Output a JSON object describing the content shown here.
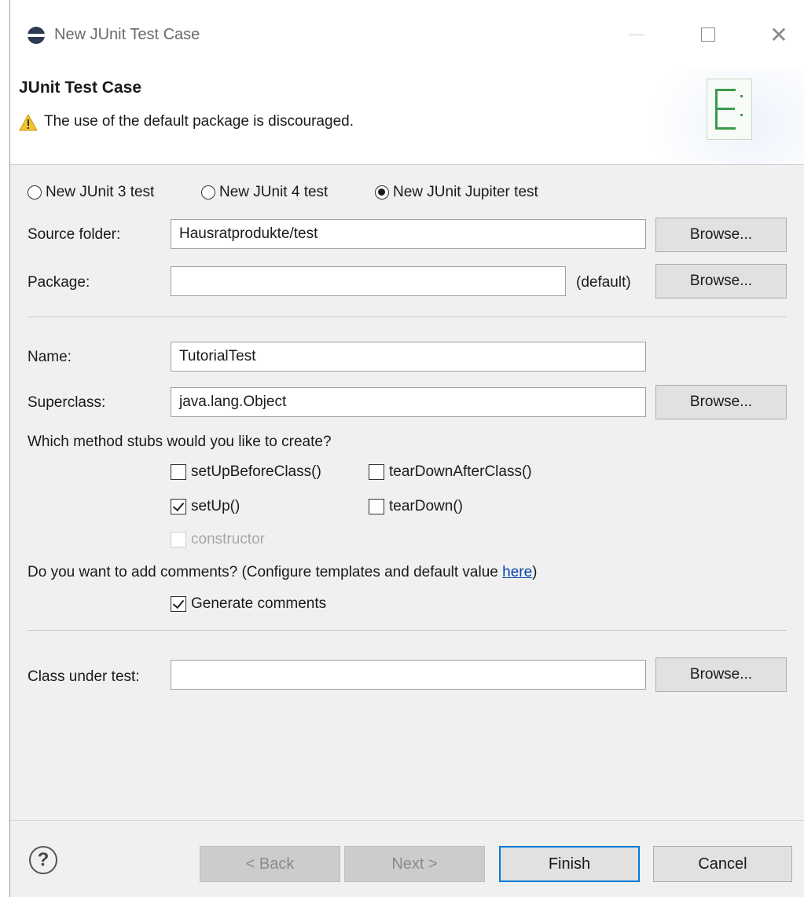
{
  "window": {
    "title": "New JUnit Test Case",
    "controls": {
      "minimize_icon": "minimize-icon",
      "maximize_icon": "maximize-icon",
      "close_glyph": "✕"
    }
  },
  "header": {
    "title": "JUnit Test Case",
    "warning_icon": "warning-icon",
    "warning_text": "The use of the default package is discouraged."
  },
  "junit_version": {
    "options": [
      "New JUnit 3 test",
      "New JUnit 4 test",
      "New JUnit Jupiter test"
    ],
    "selected": "New JUnit Jupiter test"
  },
  "form": {
    "source_folder": {
      "label": "Source folder:",
      "value": "Hausratprodukte/test",
      "browse": "Browse..."
    },
    "package": {
      "label": "Package:",
      "value": "",
      "hint": "(default)",
      "browse": "Browse..."
    },
    "name": {
      "label": "Name:",
      "value": "TutorialTest"
    },
    "superclass": {
      "label": "Superclass:",
      "value": "java.lang.Object",
      "browse": "Browse..."
    },
    "stubs": {
      "question": "Which method stubs would you like to create?",
      "setUpBeforeClass": {
        "label": "setUpBeforeClass()",
        "checked": false
      },
      "tearDownAfterClass": {
        "label": "tearDownAfterClass()",
        "checked": false
      },
      "setUp": {
        "label": "setUp()",
        "checked": true
      },
      "tearDown": {
        "label": "tearDown()",
        "checked": false
      },
      "constructor": {
        "label": "constructor",
        "checked": false,
        "enabled": false
      }
    },
    "comments": {
      "question": "Do you want to add comments? (Configure templates and default value ",
      "link": "here",
      "question_end": ")",
      "generate": {
        "label": "Generate comments",
        "checked": true
      }
    },
    "class_under_test": {
      "label": "Class under test:",
      "value": "",
      "browse": "Browse..."
    }
  },
  "footer": {
    "help_glyph": "?",
    "back": "< Back",
    "next": "Next >",
    "finish": "Finish",
    "cancel": "Cancel"
  },
  "colors": {
    "accent": "#0078d7",
    "link": "#0645ad",
    "warning": "#f2c230"
  }
}
